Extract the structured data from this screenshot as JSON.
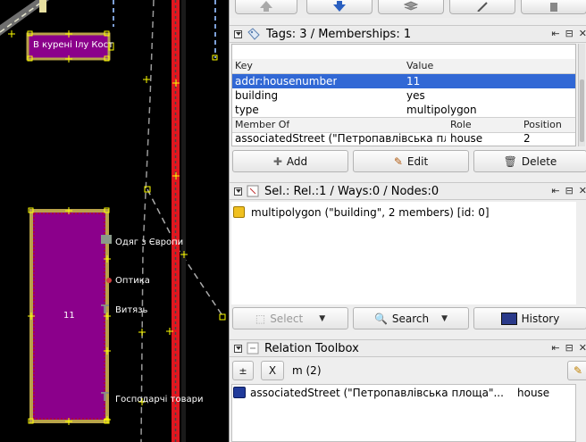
{
  "map": {
    "labels": {
      "building_top": "В курені Ілy Кост",
      "building_main": "11",
      "shop_clothes": "Одяг з Європи",
      "shop_optics": "Оптика",
      "shop_vytiaz": "Витязь",
      "shop_household": "Господарчі товари"
    }
  },
  "tags_panel": {
    "title": "Tags: 3 / Memberships: 1",
    "headers": {
      "key": "Key",
      "value": "Value"
    },
    "rows": [
      {
        "key": "addr:housenumber",
        "value": "11"
      },
      {
        "key": "building",
        "value": "yes"
      },
      {
        "key": "type",
        "value": "multipolygon"
      }
    ],
    "membership_headers": {
      "member_of": "Member Of",
      "role": "Role",
      "position": "Position"
    },
    "memberships": [
      {
        "member_of": "associatedStreet (\"Петропавлівська пло...",
        "role": "house",
        "position": "2"
      }
    ],
    "buttons": {
      "add": "Add",
      "edit": "Edit",
      "delete": "Delete"
    }
  },
  "selection_panel": {
    "title": "Sel.: Rel.:1 / Ways:0 / Nodes:0",
    "items": [
      "multipolygon (\"building\", 2 members) [id: 0]"
    ],
    "buttons": {
      "select": "Select",
      "search": "Search",
      "history": "History"
    }
  },
  "relation_toolbox": {
    "title": "Relation Toolbox",
    "role_label": "m (2)",
    "clear_label": "X",
    "items": [
      {
        "name": "associatedStreet (\"Петропавлівська площа\"...",
        "role": "house"
      }
    ]
  },
  "colors": {
    "building_fill": "#8b008b",
    "building_outline": "#b9a349",
    "road_red": "#e0171f",
    "selection_blue": "#3168d5"
  }
}
